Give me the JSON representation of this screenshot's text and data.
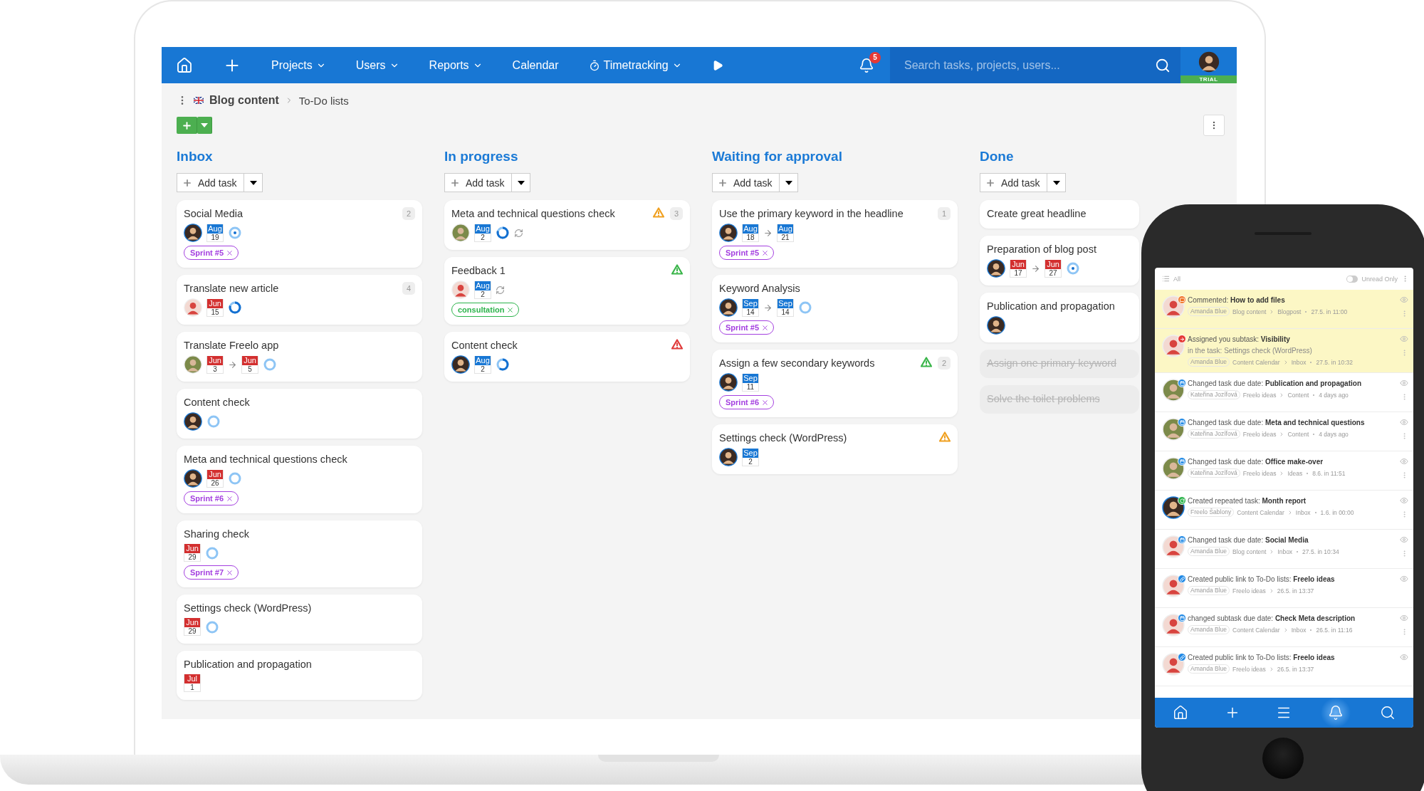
{
  "nav": {
    "menus": [
      {
        "label": "Projects",
        "dropdown": true,
        "timer": false
      },
      {
        "label": "Users",
        "dropdown": true,
        "timer": false
      },
      {
        "label": "Reports",
        "dropdown": true,
        "timer": false
      },
      {
        "label": "Calendar",
        "dropdown": false,
        "timer": false
      },
      {
        "label": "Timetracking",
        "dropdown": true,
        "timer": true
      }
    ],
    "notifications_count": "5",
    "search": {
      "placeholder": "Search tasks, projects, users..."
    },
    "user_badge": "TRIAL"
  },
  "breadcrumb": {
    "project": "Blog content",
    "page": "To-Do lists"
  },
  "columns": [
    {
      "title": "Inbox",
      "add_label": "Add task",
      "cards": [
        {
          "title": "Social Media",
          "count": "2",
          "assignee": {
            "kind": "dark"
          },
          "dates": [
            {
              "month": "Aug",
              "day": "19",
              "overdue": false
            }
          ],
          "ring": {
            "kind": "running"
          },
          "repeating": false,
          "completed": false,
          "tags": [
            {
              "label": "Sprint #5",
              "color": "#a43fe0"
            }
          ]
        },
        {
          "title": "Translate new article",
          "count": "4",
          "assignee": {
            "kind": "melon"
          },
          "dates": [
            {
              "month": "Jun",
              "day": "15",
              "overdue": true
            }
          ],
          "ring": {
            "kind": "mostly"
          },
          "repeating": false,
          "completed": false
        },
        {
          "title": "Translate Freelo app",
          "assignee": {
            "kind": "woman"
          },
          "dates": [
            {
              "month": "Jun",
              "day": "3",
              "overdue": true
            },
            {
              "month": "Jun",
              "day": "5",
              "overdue": true
            }
          ],
          "ring": {
            "kind": "open"
          },
          "repeating": false,
          "completed": false
        },
        {
          "title": "Content check",
          "assignee": {
            "kind": "dark"
          },
          "ring": {
            "kind": "open"
          },
          "repeating": false,
          "completed": false
        },
        {
          "title": "Meta and technical questions check",
          "assignee": {
            "kind": "dark"
          },
          "dates": [
            {
              "month": "Jun",
              "day": "26",
              "overdue": true
            }
          ],
          "ring": {
            "kind": "open"
          },
          "repeating": false,
          "completed": false,
          "tags": [
            {
              "label": "Sprint #6",
              "color": "#a43fe0"
            }
          ]
        },
        {
          "title": "Sharing check",
          "dates": [
            {
              "month": "Jun",
              "day": "29",
              "overdue": true
            }
          ],
          "ring": {
            "kind": "open"
          },
          "repeating": false,
          "completed": false,
          "tags": [
            {
              "label": "Sprint #7",
              "color": "#a43fe0"
            }
          ]
        },
        {
          "title": "Settings check (WordPress)",
          "dates": [
            {
              "month": "Jun",
              "day": "29",
              "overdue": true
            }
          ],
          "ring": {
            "kind": "open"
          },
          "repeating": false,
          "completed": false
        },
        {
          "title": "Publication and propagation",
          "dates": [
            {
              "month": "Jul",
              "day": "1",
              "overdue": true
            }
          ],
          "repeating": false,
          "completed": false
        }
      ]
    },
    {
      "title": "In progress",
      "add_label": "Add task",
      "cards": [
        {
          "title": "Meta and technical questions check",
          "warning": {
            "color": "#f0a020"
          },
          "count": "3",
          "assignee": {
            "kind": "woman"
          },
          "dates": [
            {
              "month": "Aug",
              "day": "2",
              "overdue": false
            }
          ],
          "ring": {
            "kind": "mostly"
          },
          "repeating": true,
          "completed": false
        },
        {
          "title": "Feedback 1",
          "warning": {
            "color": "#3ab54a"
          },
          "assignee": {
            "kind": "melon"
          },
          "dates": [
            {
              "month": "Aug",
              "day": "2",
              "overdue": false
            }
          ],
          "repeating": true,
          "completed": false,
          "tags": [
            {
              "label": "consultation",
              "color": "#2bb34a"
            }
          ]
        },
        {
          "title": "Content check",
          "warning": {
            "color": "#e03a3a"
          },
          "assignee": {
            "kind": "dark"
          },
          "dates": [
            {
              "month": "Aug",
              "day": "2",
              "overdue": false
            }
          ],
          "ring": {
            "kind": "half"
          },
          "repeating": false,
          "completed": false
        }
      ]
    },
    {
      "title": "Waiting for approval",
      "add_label": "Add task",
      "cards": [
        {
          "title": "Use the primary keyword in the headline",
          "count": "1",
          "assignee": {
            "kind": "dark"
          },
          "dates": [
            {
              "month": "Aug",
              "day": "18",
              "overdue": false
            },
            {
              "month": "Aug",
              "day": "21",
              "overdue": false
            }
          ],
          "repeating": false,
          "completed": false,
          "tags": [
            {
              "label": "Sprint #5",
              "color": "#a43fe0"
            }
          ]
        },
        {
          "title": "Keyword Analysis",
          "assignee": {
            "kind": "dark"
          },
          "dates": [
            {
              "month": "Sep",
              "day": "14",
              "overdue": false
            },
            {
              "month": "Sep",
              "day": "14",
              "overdue": false
            }
          ],
          "ring": {
            "kind": "open"
          },
          "repeating": false,
          "completed": false,
          "tags": [
            {
              "label": "Sprint #5",
              "color": "#a43fe0"
            }
          ]
        },
        {
          "title": "Assign a few secondary keywords",
          "warning": {
            "color": "#3ab54a"
          },
          "count": "2",
          "assignee": {
            "kind": "dark"
          },
          "dates": [
            {
              "month": "Sep",
              "day": "11",
              "overdue": false
            }
          ],
          "repeating": false,
          "completed": false,
          "tags": [
            {
              "label": "Sprint #6",
              "color": "#a43fe0"
            }
          ]
        },
        {
          "title": "Settings check (WordPress)",
          "warning": {
            "color": "#f0a020"
          },
          "assignee": {
            "kind": "dark"
          },
          "dates": [
            {
              "month": "Sep",
              "day": "2",
              "overdue": false
            }
          ],
          "repeating": false,
          "completed": false
        }
      ]
    },
    {
      "title": "Done",
      "add_label": "Add task",
      "cards": [
        {
          "title": "Create great headline",
          "repeating": false,
          "completed": false
        },
        {
          "title": "Preparation of blog post",
          "assignee": {
            "kind": "dark"
          },
          "dates": [
            {
              "month": "Jun",
              "day": "17",
              "overdue": true
            },
            {
              "month": "Jun",
              "day": "27",
              "overdue": true
            }
          ],
          "ring": {
            "kind": "running"
          },
          "repeating": false,
          "completed": false
        },
        {
          "title": "Publication and propagation",
          "assignee": {
            "kind": "dark"
          },
          "repeating": false,
          "completed": false
        },
        {
          "title": "Assign one primary keyword",
          "repeating": false,
          "completed": true
        },
        {
          "title": "Solve the toilet problems",
          "repeating": false,
          "completed": true
        }
      ]
    }
  ],
  "phone": {
    "filter": "All",
    "unread_only_label": "Unread Only",
    "unread_only": false,
    "notifications": [
      {
        "avatar": {
          "kind": "melon"
        },
        "badge": {
          "kind": "comment"
        },
        "unread": true,
        "text": "Commented: **How to add files**",
        "author": "Amanda Blue",
        "path": [
          "Blog content",
          "Blogpost"
        ],
        "separator": {
          "kind": "dot"
        },
        "time": "27.5. in 11:00",
        "menu": true
      },
      {
        "avatar": {
          "kind": "melon"
        },
        "badge": {
          "kind": "assign"
        },
        "unread": true,
        "text": "Assigned you subtask: **Visibility**",
        "detail": "in the task: Settings check (WordPress)",
        "author": "Amanda Blue",
        "path": [
          "Content Calendar",
          "Inbox"
        ],
        "separator": {
          "kind": "dot"
        },
        "time": "27.5. in 10:32",
        "menu": true
      },
      {
        "avatar": {
          "kind": "woman"
        },
        "badge": {
          "kind": "date"
        },
        "unread": false,
        "text": "Changed task due date: **Publication and propagation**",
        "author": "Kateřina Jozífová",
        "path": [
          "Freelo ideas",
          "Content"
        ],
        "separator": {
          "kind": "dot"
        },
        "time": "4 days ago",
        "menu": true
      },
      {
        "avatar": {
          "kind": "woman"
        },
        "badge": {
          "kind": "date"
        },
        "unread": false,
        "text": "Changed task due date: **Meta and technical questions**",
        "author": "Kateřina Jozífová",
        "path": [
          "Freelo ideas",
          "Content"
        ],
        "separator": {
          "kind": "dot"
        },
        "time": "4 days ago",
        "menu": true
      },
      {
        "avatar": {
          "kind": "woman"
        },
        "badge": {
          "kind": "date"
        },
        "unread": false,
        "text": "Changed task due date: **Office make-over**",
        "author": "Kateřina Jozífová",
        "path": [
          "Freelo ideas",
          "Ideas"
        ],
        "separator": {
          "kind": "dot"
        },
        "time": "8.6. in 11:51",
        "menu": true
      },
      {
        "avatar": {
          "kind": "dark"
        },
        "badge": {
          "kind": "repeat"
        },
        "unread": false,
        "text": "Created repeated task: **Month report**",
        "author": "Freelo Šablony",
        "path": [
          "Content Calendar",
          "Inbox"
        ],
        "separator": {
          "kind": "dot"
        },
        "time": "1.6. in 00:00",
        "menu": true
      },
      {
        "avatar": {
          "kind": "melon"
        },
        "badge": {
          "kind": "date"
        },
        "unread": false,
        "text": "Changed task due date: **Social Media**",
        "author": "Amanda Blue",
        "path": [
          "Blog content",
          "Inbox"
        ],
        "separator": {
          "kind": "dot"
        },
        "time": "27.5. in 10:34",
        "menu": true
      },
      {
        "avatar": {
          "kind": "melon"
        },
        "badge": {
          "kind": "link"
        },
        "unread": false,
        "text": "Created public link to To-Do lists: **Freelo ideas**",
        "author": "Amanda Blue",
        "path": [
          "Freelo ideas"
        ],
        "separator": {
          "kind": "chevron"
        },
        "time": "26.5. in 13:37",
        "menu": false
      },
      {
        "avatar": {
          "kind": "melon"
        },
        "badge": {
          "kind": "date"
        },
        "unread": false,
        "text": "changed subtask due date: **Check Meta description**",
        "author": "Amanda Blue",
        "path": [
          "Content Calendar",
          "Inbox"
        ],
        "separator": {
          "kind": "dot"
        },
        "time": "26.5. in 11:16",
        "menu": true
      },
      {
        "avatar": {
          "kind": "melon"
        },
        "badge": {
          "kind": "link"
        },
        "unread": false,
        "text": "Created public link to To-Do lists: **Freelo ideas**",
        "author": "Amanda Blue",
        "path": [
          "Freelo ideas"
        ],
        "separator": {
          "kind": "chevron"
        },
        "time": "26.5. in 13:37",
        "menu": false
      }
    ],
    "tabs": [
      {
        "kind": "home",
        "selected": false
      },
      {
        "kind": "add",
        "selected": false
      },
      {
        "kind": "list",
        "selected": false
      },
      {
        "kind": "bell",
        "selected": true
      },
      {
        "kind": "search",
        "selected": false
      }
    ]
  }
}
